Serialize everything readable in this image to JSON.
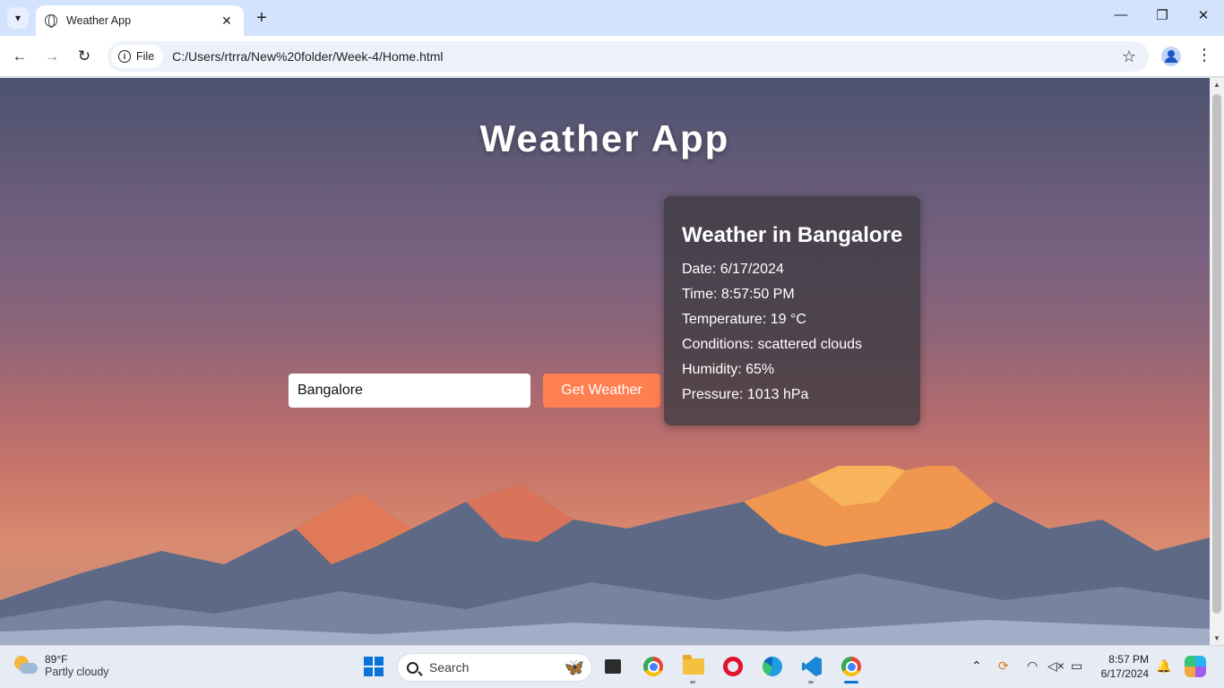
{
  "browser": {
    "tab_title": "Weather App",
    "new_tab_symbol": "+",
    "tab_close_symbol": "✕",
    "chip_label": "File",
    "url": "C:/Users/rtrra/New%20folder/Week-4/Home.html"
  },
  "page": {
    "title": "Weather App",
    "search": {
      "value": "Bangalore",
      "placeholder": ""
    },
    "button_label": "Get Weather",
    "weather": {
      "heading": "Weather in Bangalore",
      "date": "Date: 6/17/2024",
      "time": "Time: 8:57:50 PM",
      "temperature": "Temperature: 19 °C",
      "conditions": "Conditions: scattered clouds",
      "humidity": "Humidity: 65%",
      "pressure": "Pressure: 1013 hPa"
    }
  },
  "taskbar": {
    "weather_temp": "89°F",
    "weather_condition": "Partly cloudy",
    "search_label": "Search",
    "clock_time": "8:57 PM",
    "clock_date": "6/17/2024",
    "apps": [
      "windows-start",
      "search",
      "microsoft-store",
      "chrome",
      "file-explorer",
      "opera",
      "edge",
      "vscode",
      "chrome-active"
    ]
  },
  "colors": {
    "accent_button": "#ff7f50",
    "card_bg": "#3c3a40",
    "title_text": "#ffffff"
  }
}
